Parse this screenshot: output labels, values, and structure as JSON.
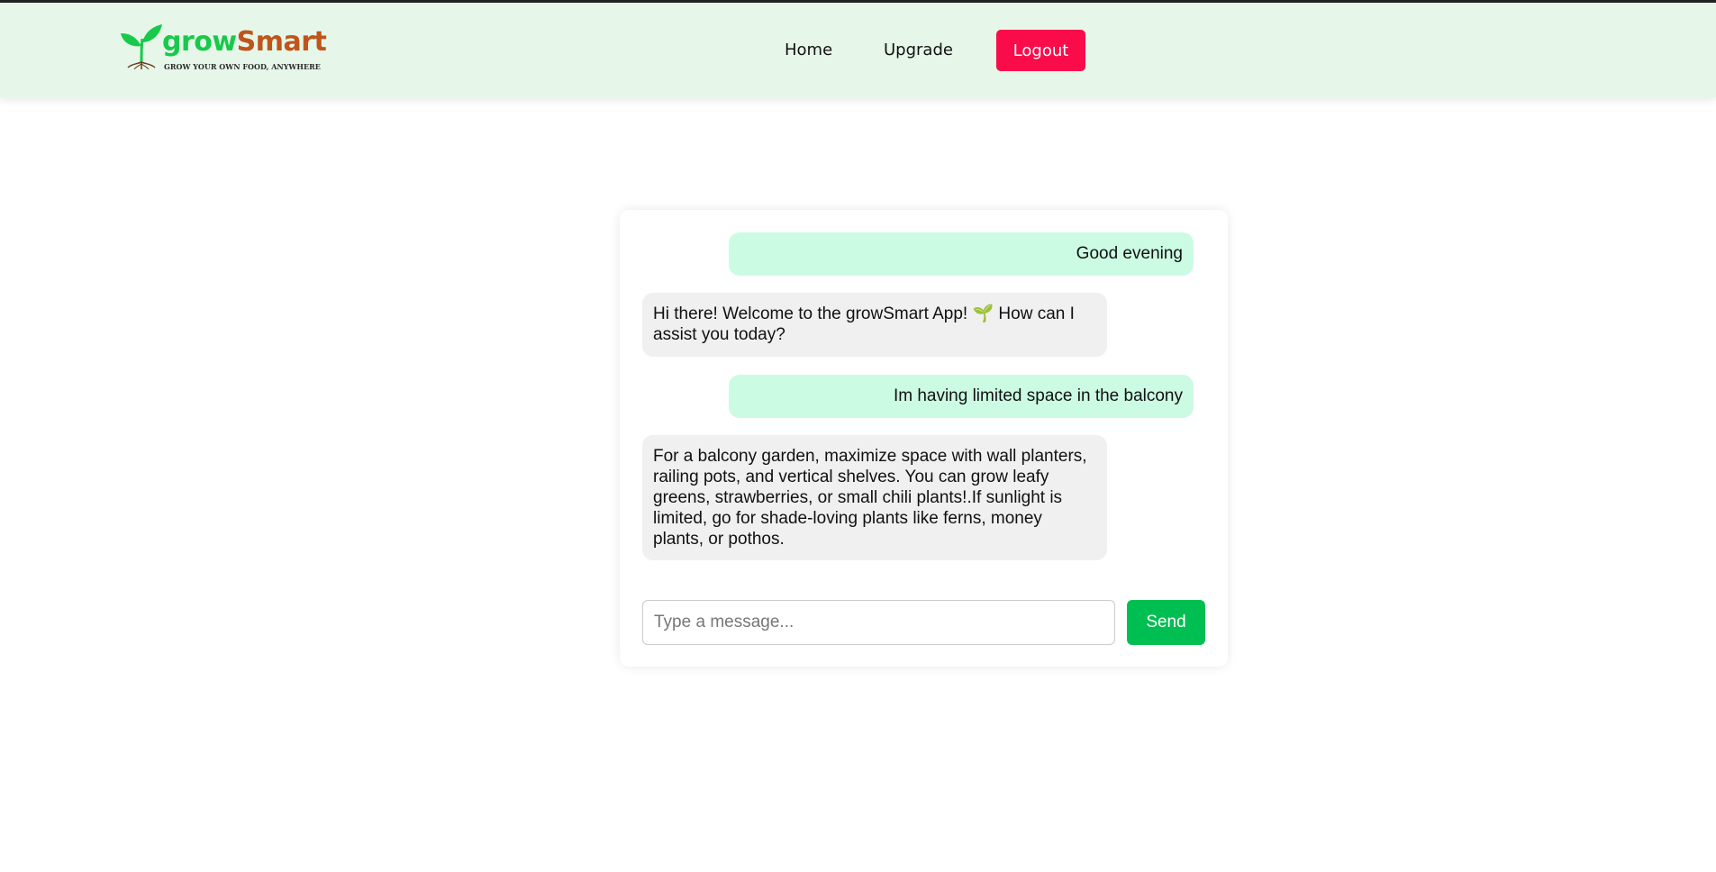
{
  "brand": {
    "name_part1": "grow",
    "name_part2": "Smart",
    "tagline": "GROW YOUR OWN FOOD, ANYWHERE",
    "colors": {
      "green": "#19c94a",
      "orange": "#c0541a"
    }
  },
  "nav": {
    "home_label": "Home",
    "upgrade_label": "Upgrade",
    "logout_label": "Logout",
    "logout_color": "#fa0b4a"
  },
  "chat": {
    "messages": [
      {
        "role": "user",
        "text": "Good evening"
      },
      {
        "role": "bot",
        "text": "Hi there! Welcome to the growSmart App! 🌱 How can I assist you today?"
      },
      {
        "role": "user",
        "text": "Im having limited space in the balcony"
      },
      {
        "role": "bot",
        "text": "For a balcony garden, maximize space with wall planters, railing pots, and vertical shelves. You can grow leafy greens, strawberries, or small chili plants!.If sunlight is limited, go for shade-loving plants like ferns, money plants, or pothos."
      }
    ],
    "input_placeholder": "Type a message...",
    "input_value": "",
    "send_label": "Send",
    "colors": {
      "user_bubble": "#ccfbe4",
      "bot_bubble": "#f0f0f0",
      "send": "#00bf52"
    }
  }
}
